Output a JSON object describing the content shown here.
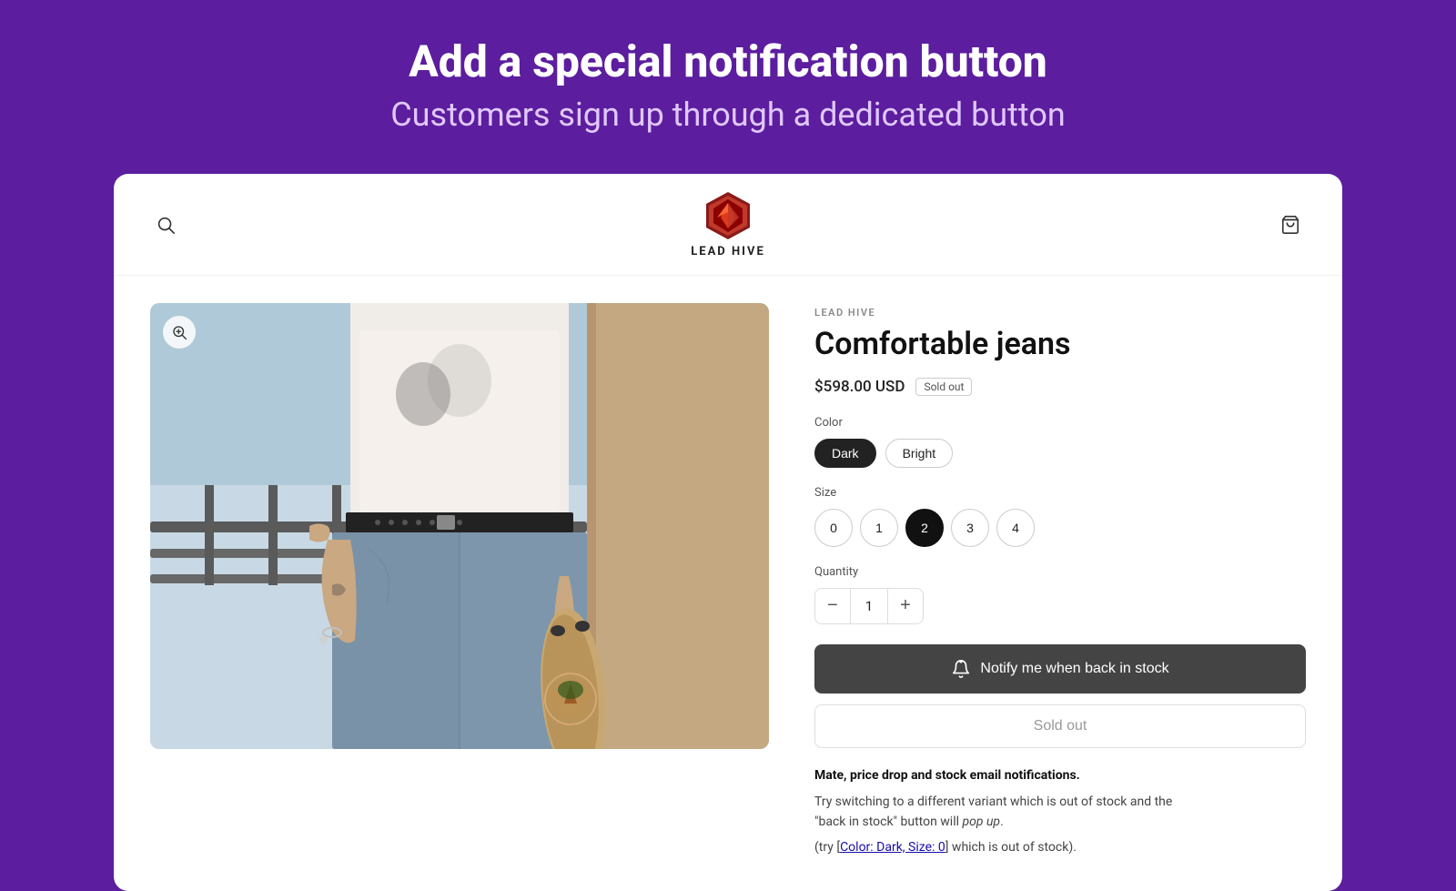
{
  "banner": {
    "title": "Add a special notification button",
    "subtitle": "Customers sign up through a dedicated button"
  },
  "nav": {
    "brand_name": "LEAD HIVE",
    "search_label": "Search",
    "cart_label": "Cart"
  },
  "product": {
    "brand": "LEAD HIVE",
    "title": "Comfortable jeans",
    "price": "$598.00 USD",
    "status": "Sold out",
    "color_label": "Color",
    "colors": [
      {
        "value": "Dark",
        "selected": true
      },
      {
        "value": "Bright",
        "selected": false
      }
    ],
    "size_label": "Size",
    "sizes": [
      {
        "value": "0",
        "selected": false
      },
      {
        "value": "1",
        "selected": false
      },
      {
        "value": "2",
        "selected": true
      },
      {
        "value": "3",
        "selected": false
      },
      {
        "value": "4",
        "selected": false
      }
    ],
    "quantity_label": "Quantity",
    "quantity": "1",
    "notify_btn_label": "Notify me when back in stock",
    "sold_out_btn_label": "Sold out",
    "description_bold": "Mate, price drop and stock email notifications.",
    "description_line1": "Try switching to a different variant which is out of stock and the",
    "description_line1_italic": "\"back in stock\" button will pop up.",
    "description_hint": "(try [Color: Dark, Size: 0] which is out of stock)."
  }
}
